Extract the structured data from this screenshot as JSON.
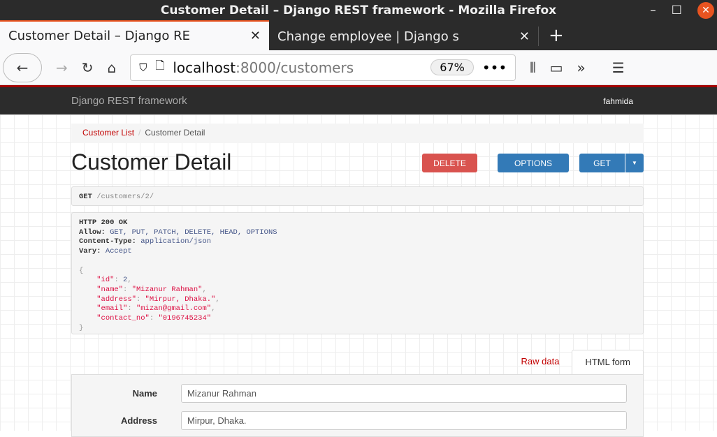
{
  "window": {
    "title": "Customer Detail – Django REST framework - Mozilla Firefox"
  },
  "tabs": [
    {
      "label": "Customer Detail – Django RE"
    },
    {
      "label": "Change employee | Django s"
    }
  ],
  "address": {
    "host": "localhost",
    "rest": ":8000/customers",
    "zoom": "67%"
  },
  "drf": {
    "brand": "Django REST framework",
    "user": "fahmida"
  },
  "breadcrumb": {
    "list": "Customer List",
    "current": "Customer Detail"
  },
  "page": {
    "title": "Customer Detail",
    "delete": "DELETE",
    "options": "OPTIONS",
    "get": "GET"
  },
  "request": {
    "method": "GET",
    "path": "/customers/2/"
  },
  "response": {
    "status": "HTTP 200 OK",
    "allow_k": "Allow:",
    "allow": "GET, PUT, PATCH, DELETE, HEAD, OPTIONS",
    "ct_k": "Content-Type:",
    "ct": "application/json",
    "vary_k": "Vary:",
    "vary": "Accept",
    "json": [
      {
        "k": "\"id\"",
        "v": "2",
        "num": true
      },
      {
        "k": "\"name\"",
        "v": "\"Mizanur Rahman\""
      },
      {
        "k": "\"address\"",
        "v": "\"Mirpur, Dhaka.\""
      },
      {
        "k": "\"email\"",
        "v": "\"mizan@gmail.com\""
      },
      {
        "k": "\"contact_no\"",
        "v": "\"0196745234\""
      }
    ]
  },
  "formtabs": {
    "raw": "Raw data",
    "html": "HTML form"
  },
  "form": {
    "name_label": "Name",
    "name": "Mizanur Rahman",
    "address_label": "Address",
    "address": "Mirpur, Dhaka."
  }
}
